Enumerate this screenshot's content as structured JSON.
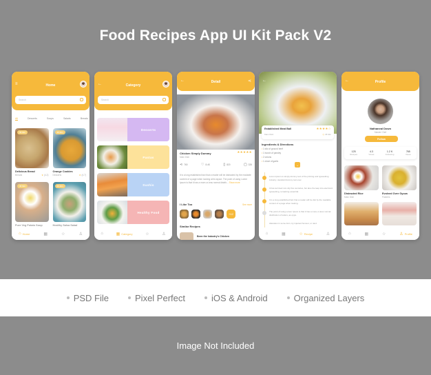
{
  "title": "Food Recipes App UI Kit Pack V2",
  "accent_color": "#f6b93b",
  "screens": {
    "home": {
      "header_title": "Home",
      "menu_icon": "hamburger-icon",
      "search_placeholder": "Search",
      "tabs": [
        "All",
        "Desserts",
        "Soups",
        "Salads",
        "Breads"
      ],
      "active_tab": "All",
      "cards": [
        {
          "badge": "45 Min",
          "name": "Delicious Bread",
          "category": "Breads",
          "rating": "(4.2)"
        },
        {
          "badge": "45 Min",
          "name": "Orange Cookies",
          "category": "Desserts",
          "rating": "(4.7)"
        },
        {
          "badge": "45 Min",
          "name": "Pure Veg Potato Soup",
          "category": "",
          "rating": ""
        },
        {
          "badge": "45 Min",
          "name": "Healthy Salsa Salad",
          "category": "",
          "rating": ""
        }
      ],
      "nav": {
        "home": "Home"
      }
    },
    "category": {
      "header_title": "Category",
      "search_placeholder": "Search",
      "categories": [
        {
          "label": "Desserts",
          "color": "#d5b8f2"
        },
        {
          "label": "Pastas",
          "color": "#fde29a"
        },
        {
          "label": "Sushis",
          "color": "#b9d3f5"
        },
        {
          "label": "Healthy Food",
          "color": "#f5b5b5"
        }
      ],
      "nav": {
        "category": "Category"
      }
    },
    "detail": {
      "header_title": "Detail",
      "name": "Chicken Simply Dummy",
      "category": "Main Dish",
      "stars": "★★★★★",
      "stats": [
        {
          "icon": "share-icon",
          "value": "760"
        },
        {
          "icon": "heart-icon",
          "value": "8.4K"
        },
        {
          "icon": "bookmark-icon",
          "value": "820"
        },
        {
          "icon": "comment-icon",
          "value": "326"
        }
      ],
      "description": "It is a long established fact that a reader will be distracted by the readable content of a page when looking at its layout. The point of using Lorem Ipsum is that it has a more-or-less normal distrib...",
      "show_more": "Show more",
      "like_too_title": "I Like Too",
      "see_more": "See more",
      "extra_count": "+12",
      "similar_title": "Similar Recipes",
      "similar_item": "Been the Industry's Chicken"
    },
    "recipe": {
      "name": "Established Meat Ball",
      "category": "Main Dish",
      "stars": "★★★★☆",
      "time": "45 Min",
      "section_title": "Ingredients & Directions",
      "ingredients": [
        "1 kilo of ground beef",
        "1 bunch of parsley",
        "2 onions",
        "1 clove of garlic"
      ],
      "steps": [
        "Lorem Ipsum is simply dummy text of the printing and typesetting industry. standard dummy text ever.",
        "It has survived not only five centuries, but also the leap into electronic typesetting, remaining essential.",
        "It is a long established fact that a reader will be dist by the readable content of a page when looking.",
        "The point of using Lorem Ipsum is that it has a more-or-less normal distribution of letters, as oppo.",
        "Alteration in some form, by injected humour, or rand"
      ],
      "nav": {
        "recipe": "Recipe"
      }
    },
    "profile": {
      "header_title": "Profile",
      "name": "Nathaneal Down",
      "role": "Master Chef",
      "follow_label": "Follow",
      "stats": [
        {
          "value": "125",
          "label": "Recipes"
        },
        {
          "value": "4.3",
          "label": "Views"
        },
        {
          "value": "1.2 K",
          "label": "Following"
        },
        {
          "value": "765",
          "label": "Views"
        }
      ],
      "items": [
        {
          "name": "Distracted Rice",
          "category": "Main Dish"
        },
        {
          "name": "Evolved Over Gyoza",
          "category": "Pastries"
        }
      ],
      "nav": {
        "profile": "Profile"
      }
    }
  },
  "features": [
    "PSD File",
    "Pixel Perfect",
    "iOS & Android",
    "Organized Layers"
  ],
  "footer": "Image Not Included"
}
